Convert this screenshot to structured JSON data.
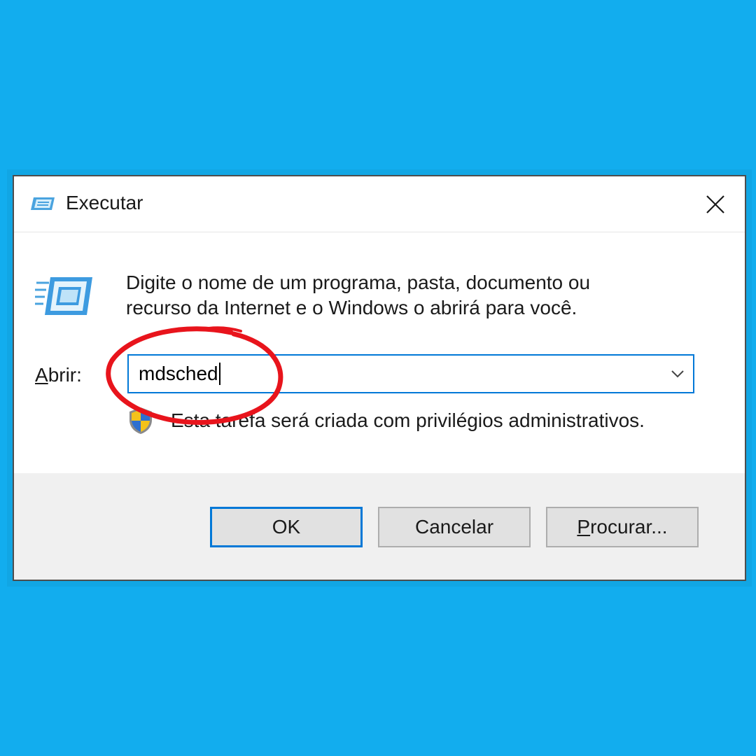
{
  "window": {
    "title": "Executar",
    "close_icon": "close-icon"
  },
  "description": {
    "line1": "Digite o nome de um programa, pasta, documento ou",
    "line2": "recurso da Internet e o Windows o abrirá para você."
  },
  "open_field": {
    "label_accel": "A",
    "label_rest": "brir:",
    "value": "mdsched",
    "dropdown_icon": "chevron-down-icon"
  },
  "admin_note": {
    "icon": "uac-shield-icon",
    "text": "Esta tarefa será criada com privilégios administrativos."
  },
  "buttons": {
    "ok": "OK",
    "cancel": "Cancelar",
    "browse_accel": "P",
    "browse_rest": "rocurar..."
  },
  "colors": {
    "background": "#12adee",
    "accent": "#0078d7",
    "annotation": "#e8141c"
  }
}
